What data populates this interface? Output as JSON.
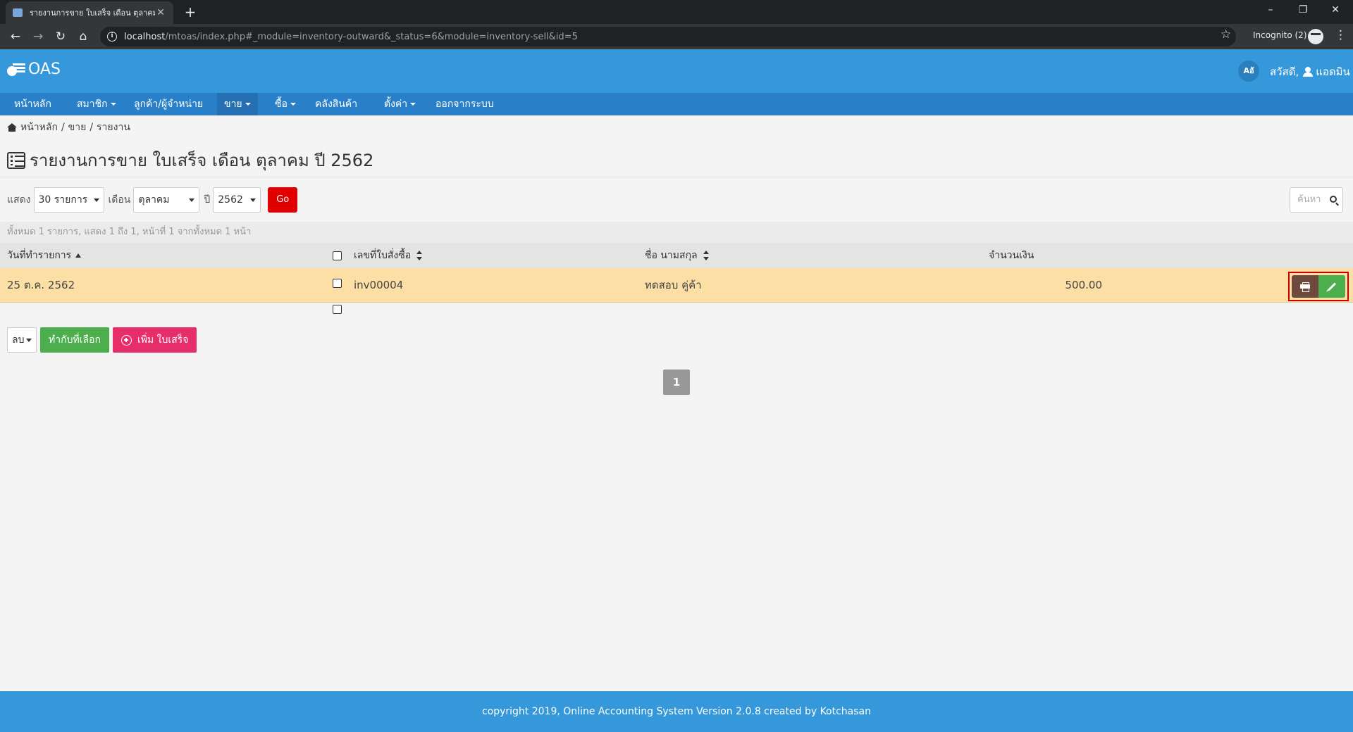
{
  "browser": {
    "tab_title": "รายงานการขาย ใบเสร็จ เดือน ตุลาคม ปี 2562",
    "url_host": "localhost",
    "url_path": "/mtoas/index.php#_module=inventory-outward&_status=6&module=inventory-sell&id=5",
    "incognito_label": "Incognito (2)"
  },
  "app": {
    "logo_text": "OAS",
    "lang_label": "Aอั",
    "greeting": "สวัสดี,",
    "username": "แอดมิน"
  },
  "nav": {
    "home": "หน้าหลัก",
    "members": "สมาชิก",
    "customers": "ลูกค้า/ผู้จำหน่าย",
    "sales": "ขาย",
    "purchase": "ซื้อ",
    "warehouse": "คลังสินค้า",
    "settings": "ตั้งค่า",
    "logout": "ออกจากระบบ"
  },
  "breadcrumb": {
    "home": "หน้าหลัก",
    "sep1": "/",
    "sales": "ขาย",
    "sep2": "/",
    "report": "รายงาน"
  },
  "page": {
    "title": "รายงานการขาย ใบเสร็จ เดือน ตุลาคม ปี 2562"
  },
  "filters": {
    "show_label": "แสดง",
    "show_value": "30 รายการ",
    "month_label": "เดือน",
    "month_value": "ตุลาคม",
    "year_label": "ปี",
    "year_value": "2562",
    "go_label": "Go",
    "search_placeholder": "ค้นหา"
  },
  "summary": "ทั้งหมด 1 รายการ, แสดง 1 ถึง 1, หน้าที่ 1 จากทั้งหมด 1 หน้า",
  "table": {
    "columns": [
      "วันที่ทำรายการ",
      "เลขที่ใบสั่งซื้อ",
      "ชื่อ นามสกุล",
      "จำนวนเงิน"
    ],
    "rows": [
      {
        "date": "25 ต.ค. 2562",
        "order_no": "inv00004",
        "name": "ทดสอบ คู่ค้า",
        "amount": "500.00"
      }
    ]
  },
  "bulk": {
    "action_value": "ลบ",
    "apply_label": "ทำกับที่เลือก",
    "add_label": "เพิ่ม ใบเสร็จ"
  },
  "pagination": {
    "current": "1"
  },
  "footer": "copyright 2019, Online Accounting System Version 2.0.8 created by Kotchasan"
}
